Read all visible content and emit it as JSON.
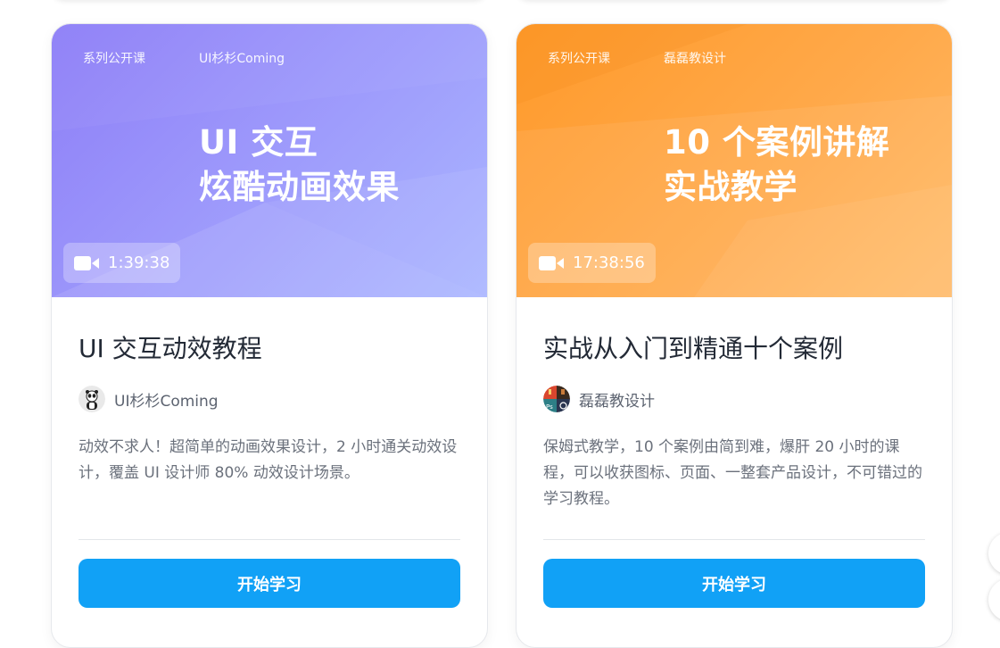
{
  "courses": [
    {
      "cover": {
        "tag_series": "系列公开课",
        "tag_author": "UI杉杉Coming",
        "title_line1": "UI 交互",
        "title_line2": "炫酷动画效果",
        "duration": "1:39:38",
        "icon": "video-camera-icon"
      },
      "title": "UI 交互动效教程",
      "author": "UI杉杉Coming",
      "description": "动效不求人！超简单的动画效果设计，2 小时通关动效设计，覆盖 UI 设计师 80% 动效设计场景。",
      "button_label": "开始学习"
    },
    {
      "cover": {
        "tag_series": "系列公开课",
        "tag_author": "磊磊教设计",
        "title_line1": "10 个案例讲解",
        "title_line2": "实战教学",
        "duration": "17:38:56",
        "icon": "video-camera-icon"
      },
      "title": "实战从入门到精通十个案例",
      "author": "磊磊教设计",
      "description": "保姆式教学，10 个案例由简到难，爆肝 20 小时的课程，可以收获图标、页面、一整套产品设计，不可错过的学习教程。",
      "button_label": "开始学习"
    }
  ],
  "colors": {
    "purple_cover": "#9c97fb",
    "orange_cover": "#ffa94a",
    "button": "#11a1f6",
    "title_text": "#232a36"
  }
}
